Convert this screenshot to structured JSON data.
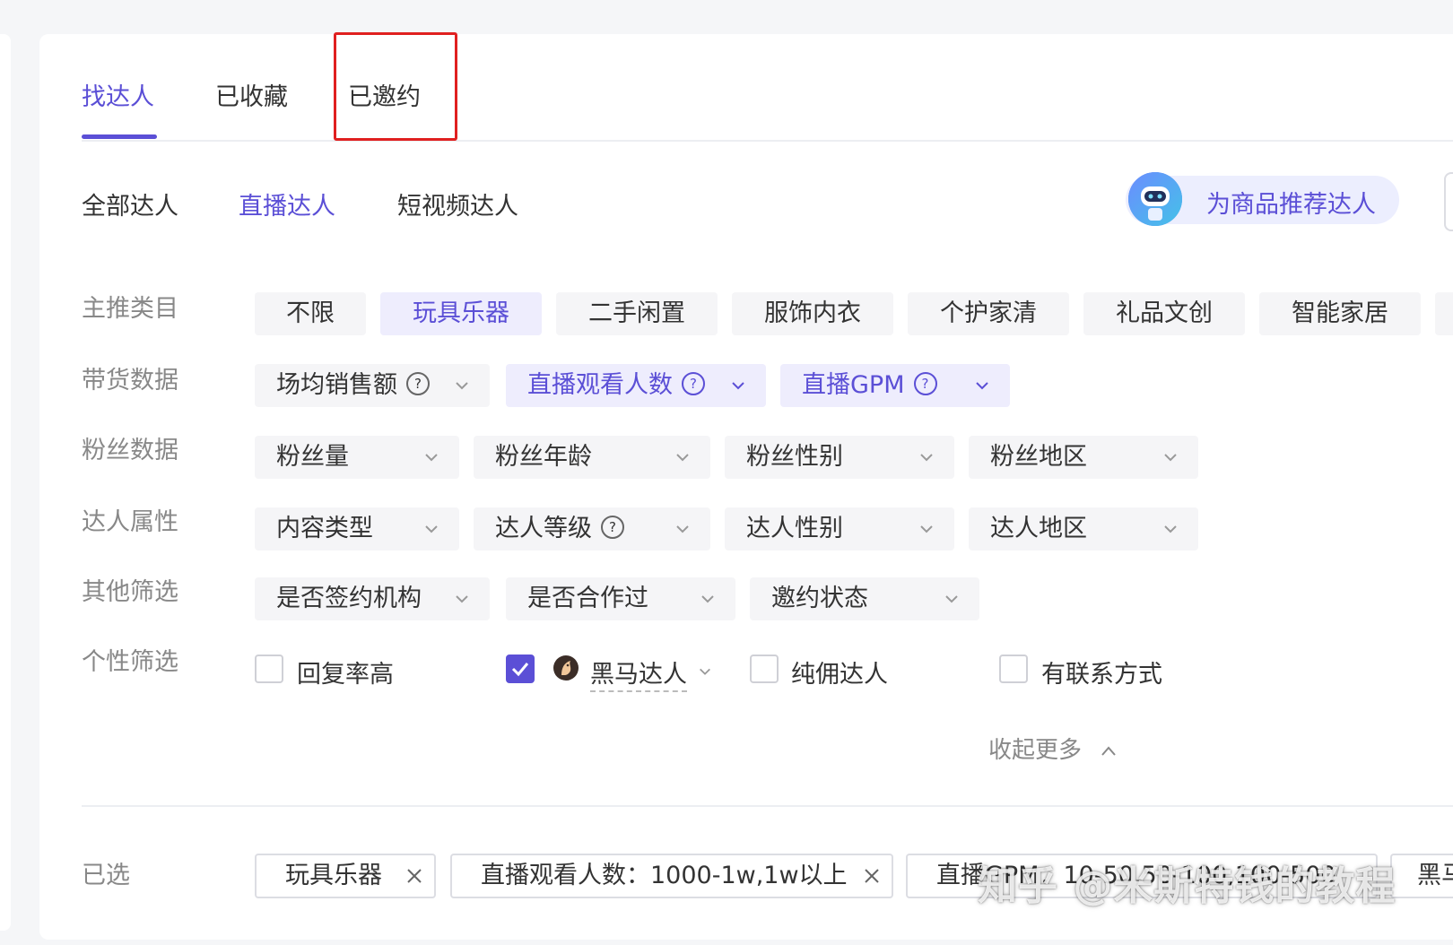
{
  "tabs": [
    {
      "label": "找达人",
      "active": true
    },
    {
      "label": "已收藏",
      "active": false
    },
    {
      "label": "已邀约",
      "active": false
    }
  ],
  "subtabs": [
    {
      "label": "全部达人",
      "active": false
    },
    {
      "label": "直播达人",
      "active": true
    },
    {
      "label": "短视频达人",
      "active": false
    }
  ],
  "recommend_button": {
    "label": "为商品推荐达人",
    "icon": "robot-icon"
  },
  "filters": {
    "category": {
      "label": "主推类目",
      "options": [
        "不限",
        "玩具乐器",
        "二手闲置",
        "服饰内衣",
        "个护家清",
        "礼品文创",
        "智能家居"
      ],
      "selected": "玩具乐器"
    },
    "sales_data": {
      "label": "带货数据",
      "dropdowns": [
        {
          "label": "场均销售额",
          "help": "?",
          "active": false
        },
        {
          "label": "直播观看人数",
          "help": "?",
          "active": true
        },
        {
          "label": "直播GPM",
          "help": "?",
          "active": true
        }
      ]
    },
    "fans_data": {
      "label": "粉丝数据",
      "dropdowns": [
        {
          "label": "粉丝量"
        },
        {
          "label": "粉丝年龄"
        },
        {
          "label": "粉丝性别"
        },
        {
          "label": "粉丝地区"
        }
      ]
    },
    "attributes": {
      "label": "达人属性",
      "dropdowns": [
        {
          "label": "内容类型"
        },
        {
          "label": "达人等级",
          "help": "?"
        },
        {
          "label": "达人性别"
        },
        {
          "label": "达人地区"
        }
      ]
    },
    "other": {
      "label": "其他筛选",
      "dropdowns": [
        {
          "label": "是否签约机构"
        },
        {
          "label": "是否合作过"
        },
        {
          "label": "邀约状态"
        }
      ]
    },
    "personal": {
      "label": "个性筛选",
      "checkboxes": [
        {
          "label": "回复率高",
          "checked": false
        },
        {
          "label": "黑马达人",
          "checked": true
        },
        {
          "label": "纯佣达人",
          "checked": false
        },
        {
          "label": "有联系方式",
          "checked": false
        }
      ]
    }
  },
  "collapse_label": "收起更多",
  "selected": {
    "label": "已选",
    "tags": [
      "玩具乐器",
      "直播观看人数：1000-1w,1w以上",
      "直播GPM：10-50,50-100,100-500",
      "黑马"
    ]
  },
  "watermark": "知乎 @米斯特钱的教程",
  "colors": {
    "accent": "#5b4fd6",
    "highlight_box": "#e02020",
    "chip_bg": "#f5f5f7"
  }
}
